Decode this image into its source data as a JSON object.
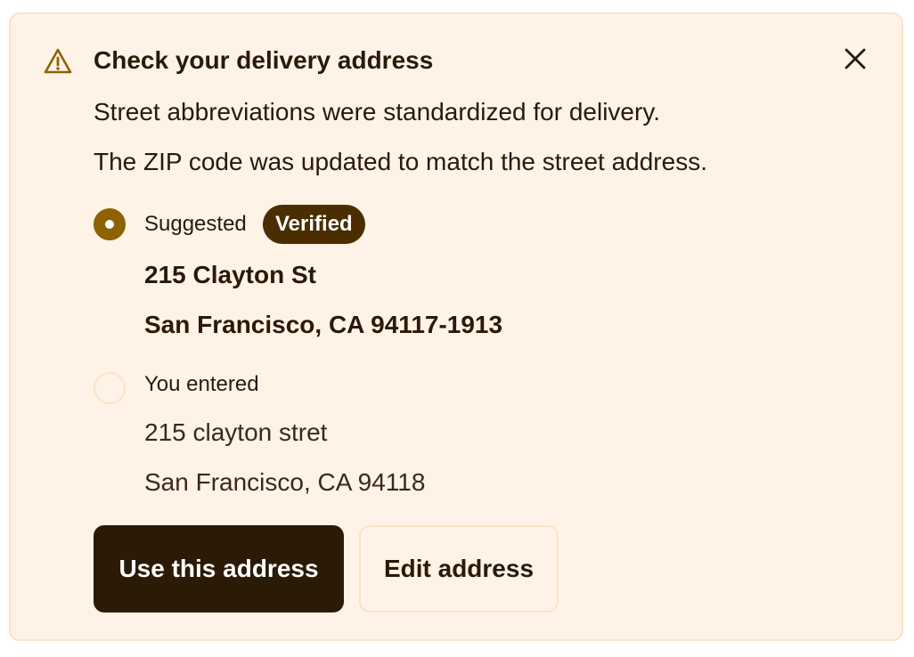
{
  "dialog": {
    "title": "Check your delivery address",
    "messages": [
      "Street abbreviations were standardized for delivery.",
      "The ZIP code was updated to match the street address."
    ]
  },
  "options": {
    "suggested": {
      "label": "Suggested",
      "badge": "Verified",
      "selected": true,
      "line1": "215 Clayton St",
      "line2": "San Francisco, CA 94117-1913"
    },
    "entered": {
      "label": "You entered",
      "selected": false,
      "line1": "215 clayton stret",
      "line2": "San Francisco, CA 94118"
    }
  },
  "actions": {
    "primary_label": "Use this address",
    "secondary_label": "Edit address"
  },
  "colors": {
    "background": "#fff3e7",
    "border": "#fbe3c4",
    "accent": "#8e6200",
    "badge": "#4a2e00",
    "primary_button": "#2a1a06"
  },
  "icons": {
    "warning": "warning-triangle-icon",
    "close": "close-icon"
  }
}
